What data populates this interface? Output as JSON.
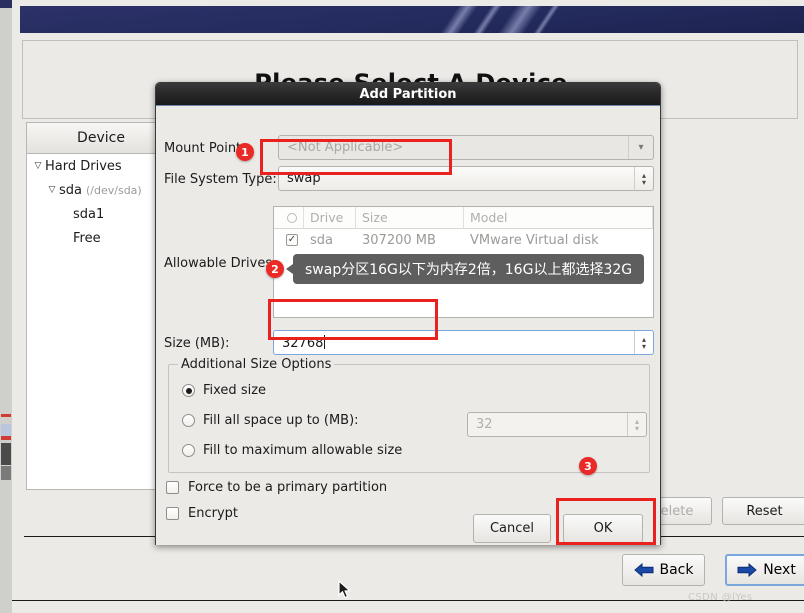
{
  "installer": {
    "page_title": "Please Select A Device",
    "device_panel": {
      "header": "Device",
      "rows": [
        {
          "label": "Hard Drives",
          "detail": "",
          "twisty": "▽",
          "indent": 4
        },
        {
          "label": "sda",
          "detail": "(/dev/sda)",
          "twisty": "▽",
          "indent": 18
        },
        {
          "label": "sda1",
          "detail": "",
          "twisty": "",
          "indent": 46
        },
        {
          "label": "Free",
          "detail": "",
          "twisty": "",
          "indent": 46
        }
      ]
    },
    "buttons": {
      "delete": "Delete",
      "reset": "Reset",
      "back": "Back",
      "next": "Next"
    },
    "watermark": "CSDN @lYes"
  },
  "dialog": {
    "title": "Add Partition",
    "mount_point": {
      "label": "Mount Point:",
      "value": "<Not Applicable>",
      "dropdown_icon": "chevron-down-icon"
    },
    "file_system_type": {
      "label": "File System Type:",
      "value": "swap",
      "spinner_icon": "up-down-chevron-icon"
    },
    "allowable_drives": {
      "label": "Allowable Drives:",
      "columns": [
        "",
        "Drive",
        "Size",
        "Model"
      ],
      "rows": [
        {
          "selected": true,
          "drive": "sda",
          "size": "307200 MB",
          "model": "VMware Virtual disk"
        }
      ]
    },
    "size": {
      "label": "Size (MB):",
      "value": "32768"
    },
    "additional_size_options": {
      "group_label": "Additional Size Options",
      "options": [
        {
          "label": "Fixed size",
          "selected": true
        },
        {
          "label": "Fill all space up to (MB):",
          "selected": false
        },
        {
          "label": "Fill to maximum allowable size",
          "selected": false
        }
      ],
      "fill_up_to_value": "32"
    },
    "checkboxes": [
      {
        "label": "Force to be a primary partition",
        "checked": false
      },
      {
        "label": "Encrypt",
        "checked": false
      }
    ],
    "actions": {
      "cancel": "Cancel",
      "ok": "OK"
    }
  },
  "annotations": {
    "accent_color": "#e8231f",
    "badge_color": "#ea2a26",
    "badges": [
      {
        "number": "1"
      },
      {
        "number": "2"
      },
      {
        "number": "3"
      }
    ],
    "tooltip": "swap分区16G以下为内存16G以上都选择32G",
    "tooltip_text": "swap分区16G以下为内存2倍，16G以上都选择32G"
  }
}
